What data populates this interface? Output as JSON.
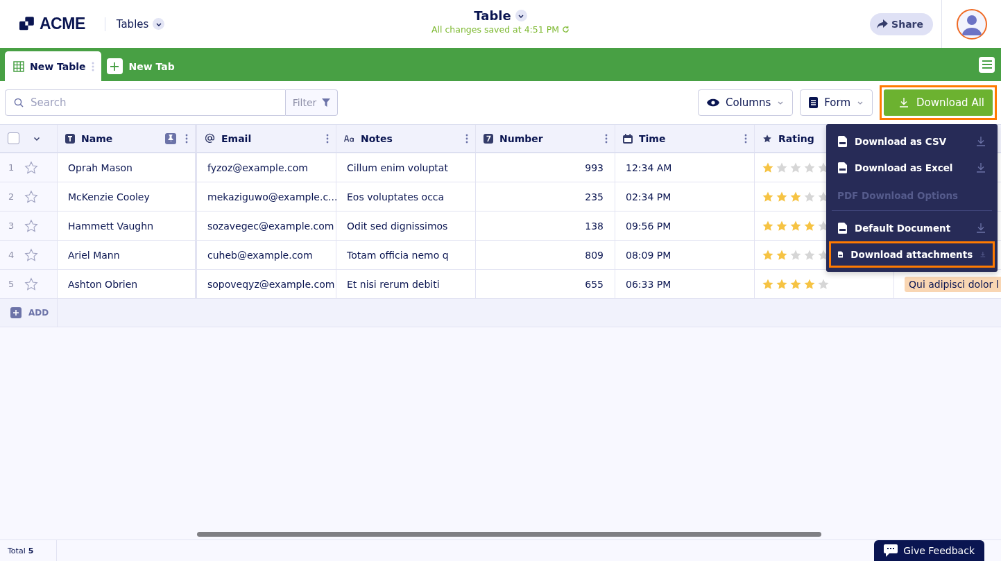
{
  "header": {
    "logo": "ACME",
    "section": "Tables",
    "title": "Table",
    "save_status": "All changes saved at 4:51 PM",
    "share": "Share"
  },
  "tabs": [
    {
      "label": "New Table",
      "selected": true
    }
  ],
  "new_tab": "New Tab",
  "toolbar": {
    "search_placeholder": "Search",
    "filter": "Filter",
    "columns": "Columns",
    "form": "Form",
    "download_all": {
      "label": "Download All",
      "highlighted": true
    }
  },
  "columns": [
    {
      "name": "Name",
      "kind": "text",
      "pinned": true
    },
    {
      "name": "Email",
      "kind": "email",
      "pinned": false
    },
    {
      "name": "Notes",
      "kind": "notes",
      "pinned": false
    },
    {
      "name": "Number",
      "kind": "number",
      "pinned": false
    },
    {
      "name": "Time",
      "kind": "time",
      "pinned": false
    },
    {
      "name": "Rating",
      "kind": "rating",
      "pinned": false
    }
  ],
  "rows": [
    {
      "index": "1",
      "starred": false,
      "name": "Oprah Mason",
      "email": "fyzoz@example.com",
      "notes": "Cillum enim voluptat",
      "number": "993",
      "time": "12:34 AM",
      "stars": 1
    },
    {
      "index": "2",
      "starred": false,
      "name": "McKenzie Cooley",
      "email": "mekaziguwo@example.c...",
      "notes": "Eos voluptates occa",
      "number": "235",
      "time": "02:34 PM",
      "stars": 3
    },
    {
      "index": "3",
      "starred": false,
      "name": "Hammett Vaughn",
      "email": "sozavegec@example.com",
      "notes": "Odit sed dignissimos",
      "number": "138",
      "time": "09:56 PM",
      "stars": 4
    },
    {
      "index": "4",
      "starred": false,
      "name": "Ariel Mann",
      "email": "cuheb@example.com",
      "notes": "Totam officia nemo q",
      "number": "809",
      "time": "08:09 PM",
      "stars": 2
    },
    {
      "index": "5",
      "starred": false,
      "name": "Ashton Obrien",
      "email": "sopoveqyz@example.com",
      "notes": "Et nisi rerum debiti",
      "number": "655",
      "time": "06:33 PM",
      "stars": 4,
      "column_8": "Qui adipisci dolor l"
    }
  ],
  "add_label": "ADD",
  "download_menu": [
    {
      "kind": "item",
      "label": "Download as CSV",
      "highlighted": false
    },
    {
      "kind": "item",
      "label": "Download as Excel",
      "highlighted": false
    },
    {
      "kind": "heading",
      "label": "PDF Download Options"
    },
    {
      "kind": "item",
      "label": "Default Document",
      "highlighted": false
    },
    {
      "kind": "item",
      "label": "Download attachments",
      "highlighted": true
    }
  ],
  "select_all": {
    "checked": false
  },
  "footer": {
    "total_label": "Total",
    "total_count": "5",
    "feedback": "Give Feedback"
  }
}
